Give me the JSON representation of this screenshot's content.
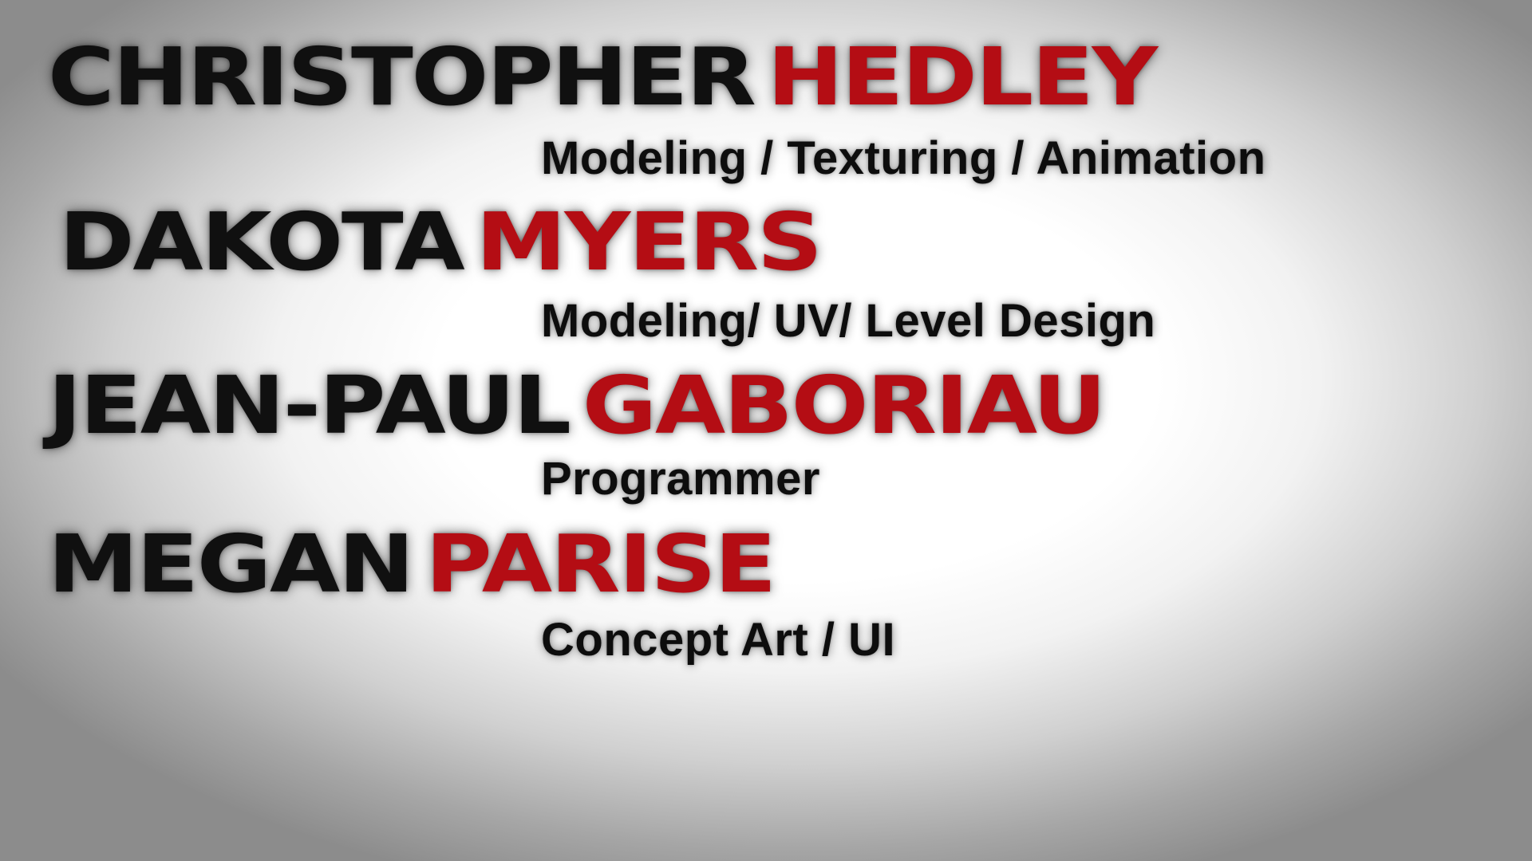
{
  "colors": {
    "first_name": "#101010",
    "last_name": "#b40d14",
    "role": "#0d0d0d"
  },
  "credits": [
    {
      "first": "CHRISTOPHER",
      "last": "HEDLEY",
      "role": "Modeling / Texturing / Animation"
    },
    {
      "first": "DAKOTA",
      "last": "MYERS",
      "role": "Modeling/ UV/ Level Design"
    },
    {
      "first": "JEAN-PAUL",
      "last": "GABORIAU",
      "role": "Programmer"
    },
    {
      "first": "MEGAN",
      "last": "PARISE",
      "role": "Concept Art / UI"
    }
  ]
}
